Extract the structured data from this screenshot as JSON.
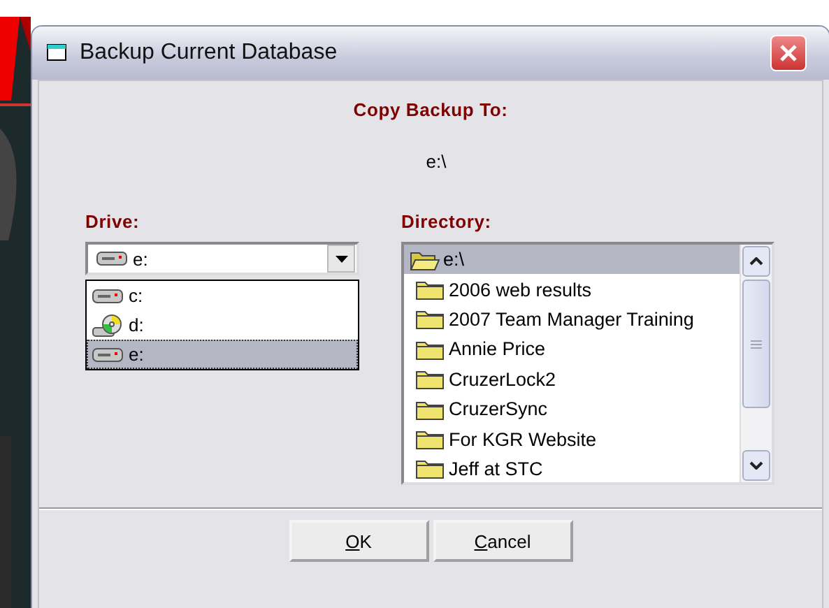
{
  "window": {
    "title": "Backup Current Database"
  },
  "heading": "Copy Backup To:",
  "destination": "e:\\",
  "drive": {
    "label": "Drive:",
    "value": "e:",
    "expanded": true,
    "options": [
      {
        "label": "c:",
        "kind": "disk",
        "selected": false
      },
      {
        "label": "d:",
        "kind": "cd",
        "selected": false
      },
      {
        "label": "e:",
        "kind": "disk",
        "selected": true
      }
    ]
  },
  "directory": {
    "label": "Directory:",
    "items": [
      {
        "label": "e:\\",
        "kind": "open",
        "selected": true
      },
      {
        "label": "2006 web results",
        "kind": "closed",
        "selected": false
      },
      {
        "label": "2007 Team Manager Training",
        "kind": "closed",
        "selected": false
      },
      {
        "label": "Annie Price",
        "kind": "closed",
        "selected": false
      },
      {
        "label": "CruzerLock2",
        "kind": "closed",
        "selected": false
      },
      {
        "label": "CruzerSync",
        "kind": "closed",
        "selected": false
      },
      {
        "label": "For KGR Website",
        "kind": "closed",
        "selected": false
      },
      {
        "label": "Jeff at STC",
        "kind": "closed",
        "selected": false
      }
    ]
  },
  "buttons": [
    "OK",
    "Cancel"
  ]
}
